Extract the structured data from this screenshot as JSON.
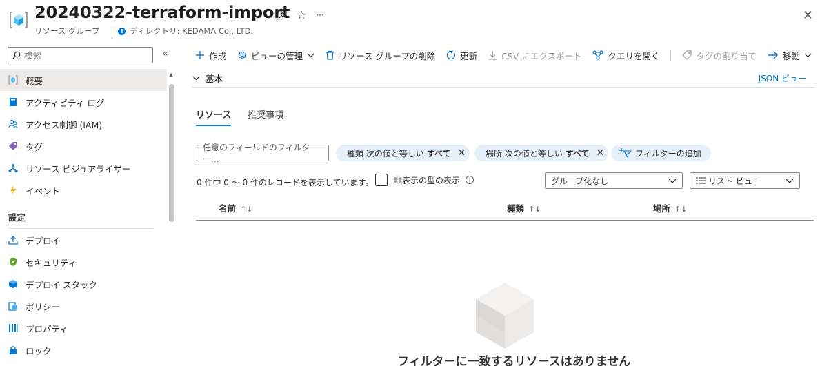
{
  "header": {
    "title": "20240322-terraform-import",
    "subtitle": "リソース グループ",
    "directory": "ディレクトリ: KEDAMA Co., LTD."
  },
  "sidebar": {
    "search_placeholder": "検索",
    "items": [
      {
        "label": "概要",
        "icon": "resource-group-icon",
        "active": true
      },
      {
        "label": "アクティビティ ログ",
        "icon": "activity-log-icon"
      },
      {
        "label": "アクセス制御 (IAM)",
        "icon": "iam-icon"
      },
      {
        "label": "タグ",
        "icon": "tag-icon"
      },
      {
        "label": "リソース ビジュアライザー",
        "icon": "visualizer-icon"
      },
      {
        "label": "イベント",
        "icon": "event-icon"
      }
    ],
    "section_settings": "設定",
    "settings_items": [
      {
        "label": "デプロイ",
        "icon": "deploy-icon"
      },
      {
        "label": "セキュリティ",
        "icon": "security-icon"
      },
      {
        "label": "デプロイ スタック",
        "icon": "deploy-stack-icon"
      },
      {
        "label": "ポリシー",
        "icon": "policy-icon"
      },
      {
        "label": "プロパティ",
        "icon": "properties-icon"
      },
      {
        "label": "ロック",
        "icon": "lock-icon"
      }
    ]
  },
  "toolbar": {
    "create": "作成",
    "manage_view": "ビューの管理",
    "delete_rg": "リソース グループの削除",
    "refresh": "更新",
    "export_csv": "CSV にエクスポート",
    "open_query": "クエリを開く",
    "assign_tags": "タグの割り当て",
    "move": "移動"
  },
  "essentials": {
    "label": "基本",
    "json_view": "JSON ビュー"
  },
  "tabs": [
    {
      "label": "リソース",
      "active": true
    },
    {
      "label": "推奨事項"
    }
  ],
  "filters": {
    "placeholder": "任意のフィールドのフィルター...",
    "type_pill_prefix": "種類 次の値と等しい",
    "type_pill_value": "すべて",
    "location_pill_prefix": "場所 次の値と等しい",
    "location_pill_value": "すべて",
    "add_filter": "フィルターの追加"
  },
  "records": {
    "count_text": "0 件中 0 ～ 0 件のレコードを表示しています。",
    "show_hidden": "非表示の型の表示",
    "grouping": "グループ化なし",
    "view_mode": "リスト ビュー"
  },
  "table": {
    "columns": [
      "名前",
      "種類",
      "場所"
    ]
  },
  "empty_state": {
    "message": "フィルターに一致するリソースはありません"
  },
  "colors": {
    "accent": "#0078d4",
    "pill_bg": "#e6f0fa",
    "active_nav": "#edebe9"
  }
}
